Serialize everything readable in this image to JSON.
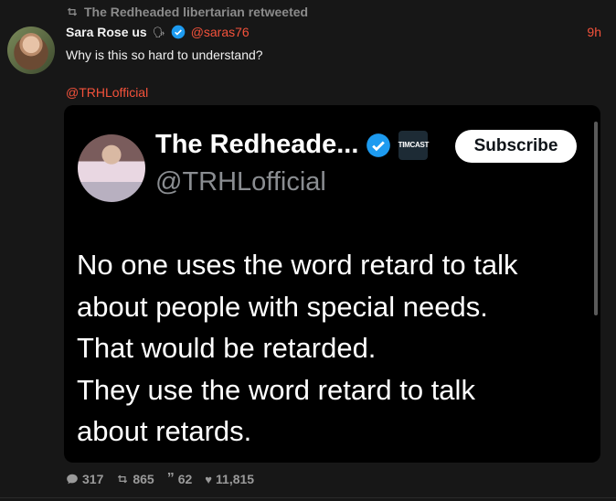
{
  "retweet": {
    "text": "The Redheaded libertarian retweeted"
  },
  "tweet": {
    "display_name": "Sara Rose us",
    "handle": "@saras76",
    "time": "9h",
    "text": "Why is this so hard to understand?",
    "mention": "@TRHLofficial"
  },
  "embedded": {
    "name": "The Redheade...",
    "handle": "@TRHLofficial",
    "badge": "TIMCAST",
    "subscribe_label": "Subscribe",
    "body": "No one uses the word retard to talk\nabout people with special needs.\nThat would be retarded.\nThey use the word retard to talk\nabout retards."
  },
  "actions": {
    "replies": "317",
    "retweets": "865",
    "quotes": "62",
    "likes": "11,815"
  },
  "colors": {
    "accent": "#f4523b",
    "background": "#171717",
    "verified": "#1d9bf0"
  }
}
